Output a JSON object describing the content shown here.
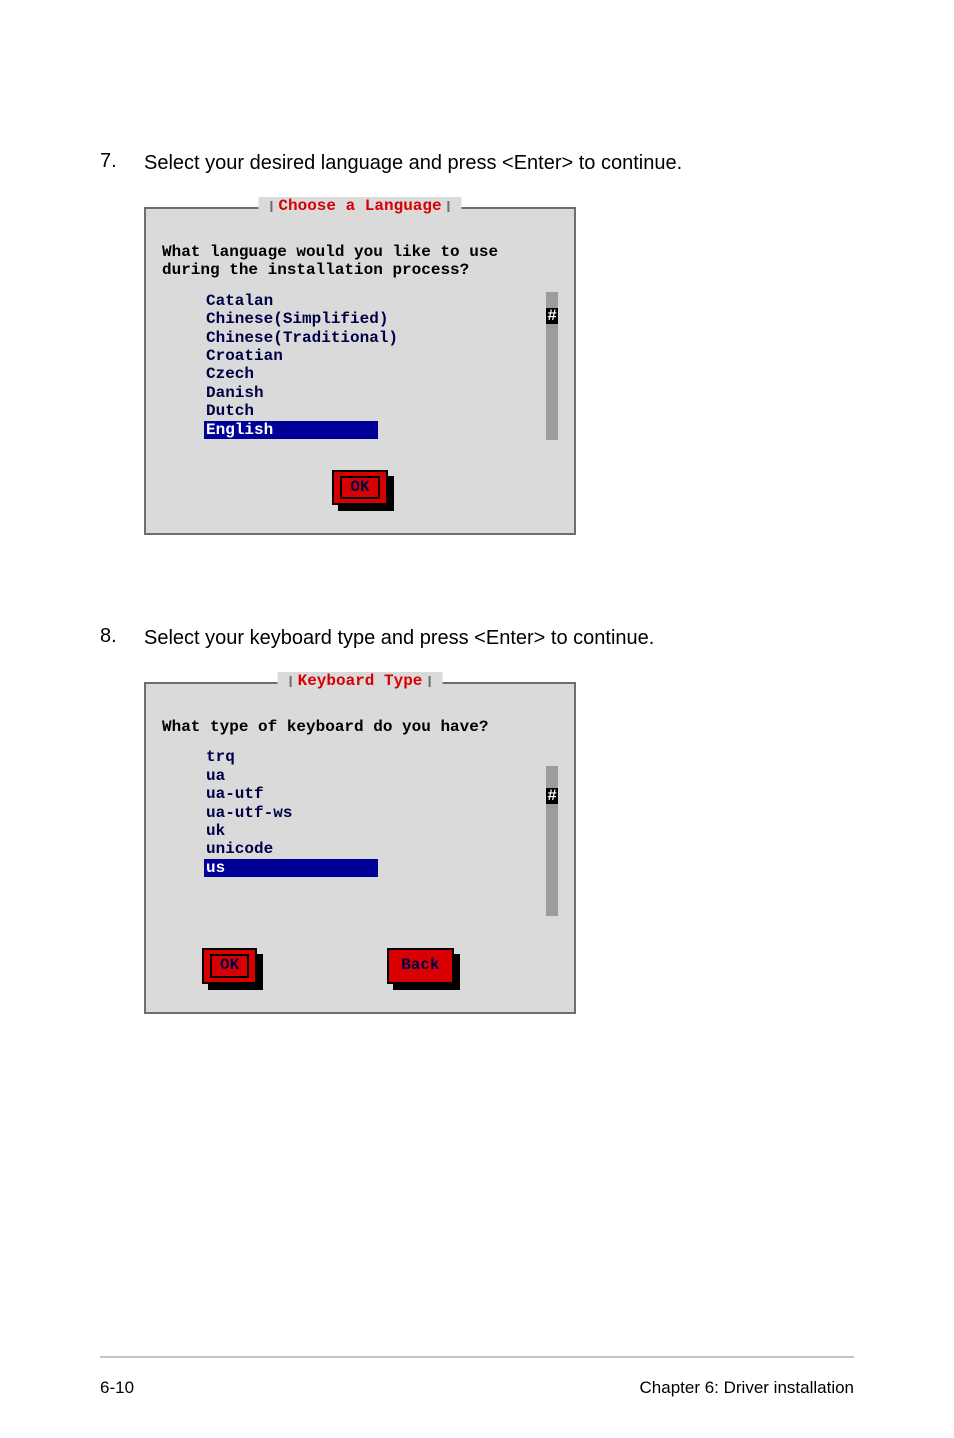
{
  "steps": [
    {
      "number": "7.",
      "text": "Select your desired language and press <Enter> to continue."
    },
    {
      "number": "8.",
      "text": "Select your keyboard type and press <Enter> to continue."
    }
  ],
  "dialog1": {
    "title": "Choose a Language",
    "prompt": "What language would you like to use\nduring the installation process?",
    "items": [
      {
        "label": "Catalan",
        "selected": false
      },
      {
        "label": "Chinese(Simplified)",
        "selected": false
      },
      {
        "label": "Chinese(Traditional)",
        "selected": false
      },
      {
        "label": "Croatian",
        "selected": false
      },
      {
        "label": "Czech",
        "selected": false
      },
      {
        "label": "Danish",
        "selected": false
      },
      {
        "label": "Dutch",
        "selected": false
      },
      {
        "label": "English",
        "selected": true
      }
    ],
    "thumb_char": "#",
    "ok_label": "OK"
  },
  "dialog2": {
    "title": "Keyboard Type",
    "prompt": "What type of keyboard do you have?",
    "items": [
      {
        "label": "trq",
        "selected": false
      },
      {
        "label": "ua",
        "selected": false
      },
      {
        "label": "ua-utf",
        "selected": false
      },
      {
        "label": "ua-utf-ws",
        "selected": false
      },
      {
        "label": "uk",
        "selected": false
      },
      {
        "label": "unicode",
        "selected": false
      },
      {
        "label": "us",
        "selected": true
      }
    ],
    "thumb_char": "#",
    "ok_label": "OK",
    "back_label": "Back"
  },
  "footer": {
    "left": "6-10",
    "right": "Chapter 6: Driver installation"
  }
}
